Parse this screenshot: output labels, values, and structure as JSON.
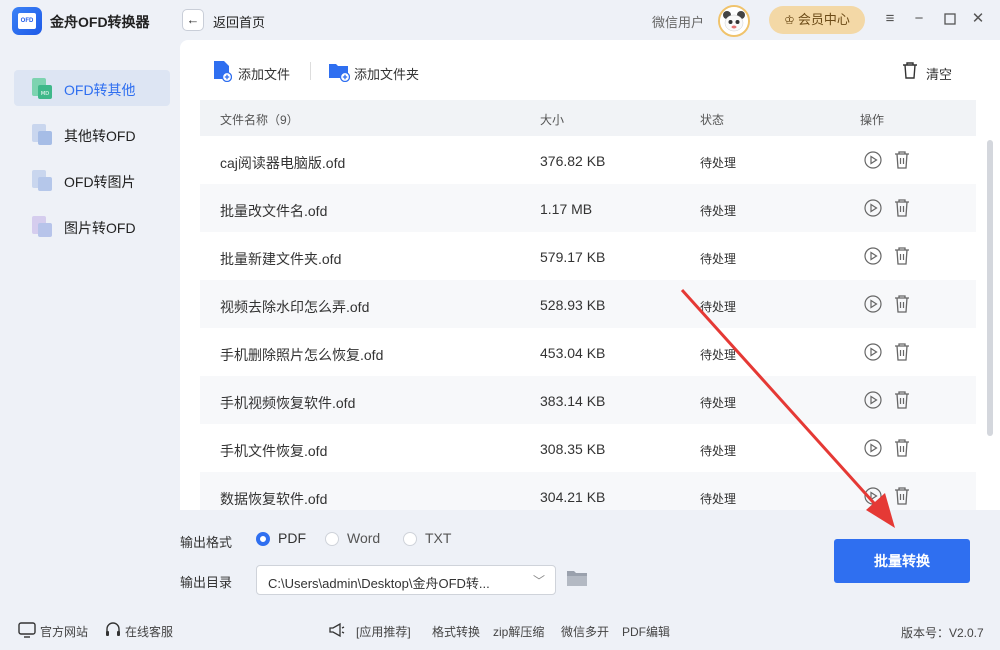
{
  "app": {
    "title": "金舟OFD转换器",
    "logo_text": "OFD"
  },
  "header": {
    "back_label": "返回首页",
    "user_name": "微信用户",
    "vip_label": "会员中心",
    "window_controls": [
      "menu-icon",
      "minimize-icon",
      "maximize-icon",
      "close-icon"
    ]
  },
  "sidebar": {
    "items": [
      {
        "label": "OFD转其他",
        "active": true
      },
      {
        "label": "其他转OFD",
        "active": false
      },
      {
        "label": "OFD转图片",
        "active": false
      },
      {
        "label": "图片转OFD",
        "active": false
      }
    ]
  },
  "toolbar": {
    "add_file": "添加文件",
    "add_folder": "添加文件夹",
    "clear": "清空"
  },
  "table": {
    "headers": [
      "文件名称（9）",
      "大小",
      "状态",
      "操作"
    ],
    "rows": [
      {
        "name": "caj阅读器电脑版.ofd",
        "size": "376.82 KB",
        "status": "待处理"
      },
      {
        "name": "批量改文件名.ofd",
        "size": "1.17 MB",
        "status": "待处理"
      },
      {
        "name": "批量新建文件夹.ofd",
        "size": "579.17 KB",
        "status": "待处理"
      },
      {
        "name": "视频去除水印怎么弄.ofd",
        "size": "528.93 KB",
        "status": "待处理"
      },
      {
        "name": "手机删除照片怎么恢复.ofd",
        "size": "453.04 KB",
        "status": "待处理"
      },
      {
        "name": "手机视频恢复软件.ofd",
        "size": "383.14 KB",
        "status": "待处理"
      },
      {
        "name": "手机文件恢复.ofd",
        "size": "308.35 KB",
        "status": "待处理"
      },
      {
        "name": "数据恢复软件.ofd",
        "size": "304.21 KB",
        "status": "待处理"
      }
    ]
  },
  "output": {
    "format_label": "输出格式",
    "formats": [
      {
        "label": "PDF",
        "selected": true
      },
      {
        "label": "Word",
        "selected": false
      },
      {
        "label": "TXT",
        "selected": false
      }
    ],
    "dir_label": "输出目录",
    "dir_value": "C:\\Users\\admin\\Desktop\\金舟OFD转..."
  },
  "convert_button": "批量转换",
  "footer": {
    "official_site": "官方网站",
    "online_service": "在线客服",
    "recommend": "[应用推荐]",
    "links": [
      "格式转换",
      "zip解压缩",
      "微信多开",
      "PDF编辑"
    ],
    "version": "版本号：V2.0.7"
  },
  "colors": {
    "accent": "#2f6ff0",
    "vip": "#f3d8a6",
    "annotation": "#e53935"
  }
}
